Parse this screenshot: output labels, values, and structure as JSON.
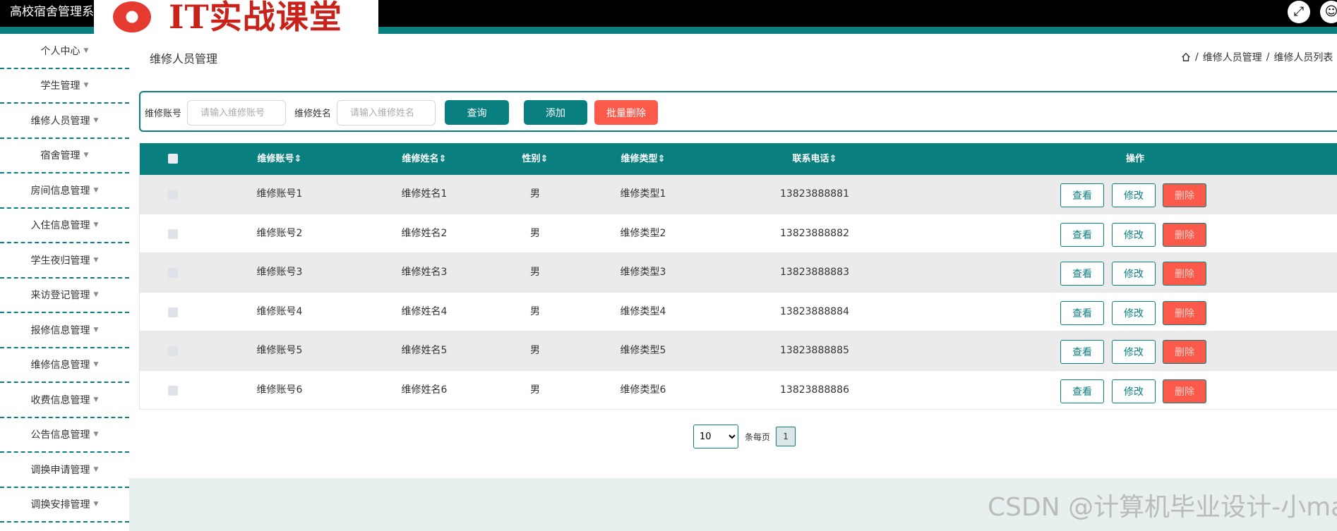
{
  "app": {
    "title": "高校宿舍管理系统"
  },
  "logo": {
    "text": "IT实战课堂"
  },
  "sidebar": {
    "items": [
      {
        "label": "个人中心"
      },
      {
        "label": "学生管理"
      },
      {
        "label": "维修人员管理"
      },
      {
        "label": "宿舍管理"
      },
      {
        "label": "房间信息管理"
      },
      {
        "label": "入住信息管理"
      },
      {
        "label": "学生夜归管理"
      },
      {
        "label": "来访登记管理"
      },
      {
        "label": "报修信息管理"
      },
      {
        "label": "维修信息管理"
      },
      {
        "label": "收费信息管理"
      },
      {
        "label": "公告信息管理"
      },
      {
        "label": "调换申请管理"
      },
      {
        "label": "调换安排管理"
      }
    ]
  },
  "page": {
    "title": "维修人员管理",
    "breadcrumb": [
      "维修人员管理",
      "维修人员列表"
    ],
    "breadcrumb_sep": "/"
  },
  "search": {
    "account_label": "维修账号",
    "account_placeholder": "请输入维修账号",
    "name_label": "维修姓名",
    "name_placeholder": "请输入维修姓名",
    "query_button": "查询",
    "add_button": "添加",
    "batch_delete_button": "批量删除"
  },
  "table": {
    "headers": {
      "account": "维修账号",
      "name": "维修姓名",
      "gender": "性别",
      "type": "维修类型",
      "phone": "联系电话",
      "actions": "操作"
    },
    "sort_icon": "sort-icon",
    "rows": [
      {
        "account": "维修账号1",
        "name": "维修姓名1",
        "gender": "男",
        "type": "维修类型1",
        "phone": "13823888881"
      },
      {
        "account": "维修账号2",
        "name": "维修姓名2",
        "gender": "男",
        "type": "维修类型2",
        "phone": "13823888882"
      },
      {
        "account": "维修账号3",
        "name": "维修姓名3",
        "gender": "男",
        "type": "维修类型3",
        "phone": "13823888883"
      },
      {
        "account": "维修账号4",
        "name": "维修姓名4",
        "gender": "男",
        "type": "维修类型4",
        "phone": "13823888884"
      },
      {
        "account": "维修账号5",
        "name": "维修姓名5",
        "gender": "男",
        "type": "维修类型5",
        "phone": "13823888885"
      },
      {
        "account": "维修账号6",
        "name": "维修姓名6",
        "gender": "男",
        "type": "维修类型6",
        "phone": "13823888886"
      }
    ],
    "actions": {
      "view": "查看",
      "edit": "修改",
      "delete": "删除"
    }
  },
  "pagination": {
    "page_size": "10",
    "page_size_options": [
      "10"
    ],
    "per_page_label": "条每页",
    "current_page": "1"
  },
  "watermark": {
    "text": "CSDN @计算机毕业设计-小ma"
  },
  "colors": {
    "teal": "#0a7f80",
    "red": "#fb5a4a",
    "topbar": "#000000",
    "row_alt": "#ebebeb"
  },
  "icons": {
    "fullscreen": "fullscreen-icon",
    "user": "user-icon",
    "home": "home-icon",
    "dropdown": "caret-down-icon"
  }
}
